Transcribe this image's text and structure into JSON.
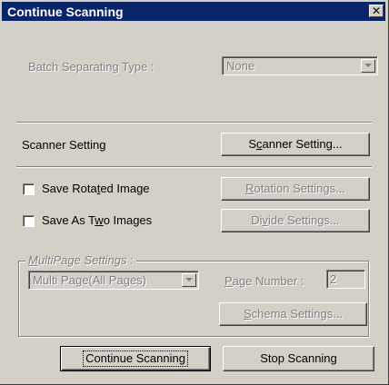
{
  "window": {
    "title": "Continue Scanning"
  },
  "batch": {
    "label": "Batch Separating Type :",
    "value": "None"
  },
  "scanner": {
    "label": "Scanner Setting",
    "button_pre": "S",
    "button_mn": "c",
    "button_post": "anner Setting..."
  },
  "rotated": {
    "label_pre": "Save Rota",
    "label_mn": "t",
    "label_post": "ed Image",
    "checked": false,
    "button_pre": "",
    "button_mn": "R",
    "button_post": "otation Settings..."
  },
  "two_images": {
    "label_pre": "Save As T",
    "label_mn": "w",
    "label_post": "o Images",
    "checked": false,
    "button_pre": "Di",
    "button_mn": "v",
    "button_post": "ide Settings..."
  },
  "multipage": {
    "group_pre": "",
    "group_mn": "M",
    "group_post": "ultiPage Settings :",
    "mode_value": "Multi Page(All Pages)",
    "page_number_pre": "",
    "page_number_mn": "P",
    "page_number_post": "age Number :",
    "page_number_value": "2",
    "schema_pre": "",
    "schema_mn": "S",
    "schema_post": "chema Settings..."
  },
  "footer": {
    "continue_label": "Continue Scanning",
    "stop_label": "Stop Scanning"
  },
  "colors": {
    "title_bar": "#0a246a",
    "face": "#d4d0c8",
    "disabled_text": "#808080"
  },
  "icons": [
    "close-icon",
    "dropdown-arrow-icon"
  ]
}
